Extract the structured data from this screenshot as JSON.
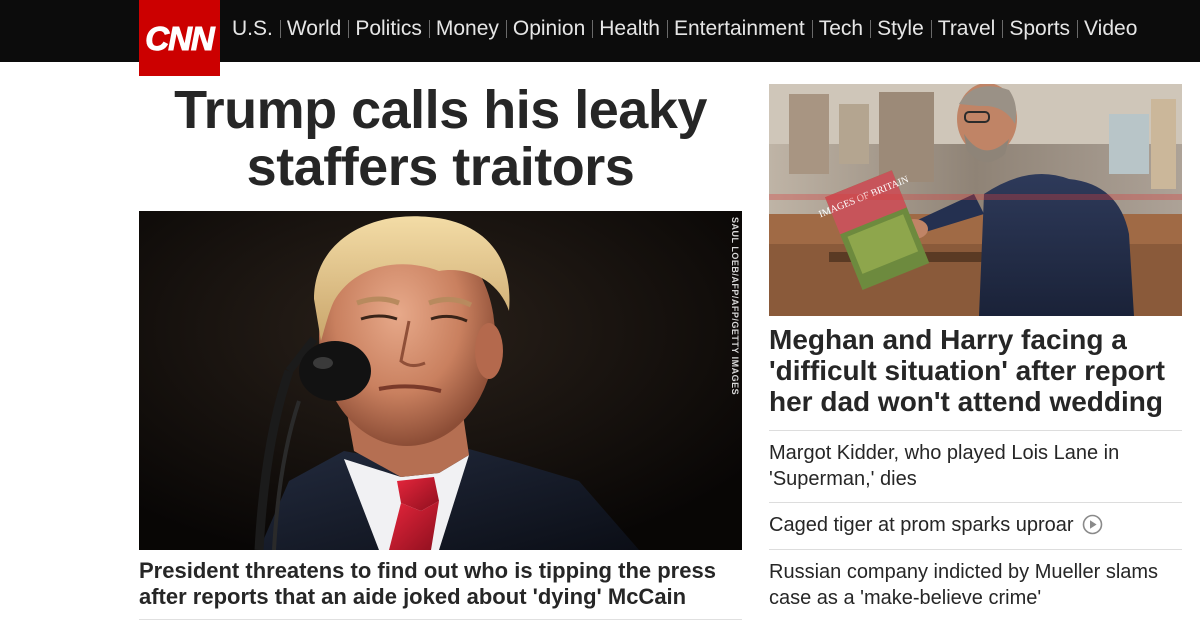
{
  "brand": {
    "logo_text": "CNN",
    "accent": "#cc0000"
  },
  "nav": {
    "items": [
      "U.S.",
      "World",
      "Politics",
      "Money",
      "Opinion",
      "Health",
      "Entertainment",
      "Tech",
      "Style",
      "Travel",
      "Sports",
      "Video"
    ]
  },
  "lead": {
    "headline": "Trump calls his leaky staffers traitors",
    "image_credit": "SAUL LOEB/AFP/AFP/GETTY IMAGES",
    "caption": "President threatens to find out who is tipping the press after reports that an aide joked about 'dying' McCain"
  },
  "side": {
    "headline": "Meghan and Harry facing a 'difficult situation' after report her dad won't attend wedding",
    "photo_book_text": "IMAGES OF BRITAIN",
    "stories": [
      {
        "text": "Margot Kidder, who played Lois Lane in 'Superman,' dies",
        "video": false
      },
      {
        "text": "Caged tiger at prom sparks uproar",
        "video": true,
        "icon": "play-icon"
      },
      {
        "text": "Russian company indicted by Mueller slams case as a 'make-believe crime'",
        "video": false
      }
    ]
  }
}
